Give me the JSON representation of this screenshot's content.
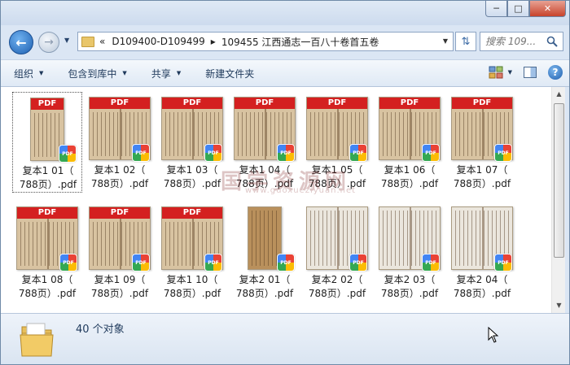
{
  "window": {
    "minimize_glyph": "─",
    "maximize_glyph": "□",
    "close_glyph": "✕"
  },
  "address": {
    "overflow": "«",
    "segments": [
      "D109400-D109499",
      "109455 江西通志一百八十卷首五卷"
    ],
    "separator": "▸"
  },
  "search": {
    "placeholder": "搜索 109..."
  },
  "toolbar": {
    "organize": "组织",
    "include_library": "包含到库中",
    "share": "共享",
    "new_folder": "新建文件夹"
  },
  "files": [
    {
      "name": "复本1 01（788页）.pdf",
      "line1": "复本1 01（",
      "line2": "788页）.pdf",
      "style": "narrow"
    },
    {
      "name": "复本1 02（788页）.pdf",
      "line1": "复本1 02（",
      "line2": "788页）.pdf",
      "style": "wide"
    },
    {
      "name": "复本1 03（788页）.pdf",
      "line1": "复本1 03（",
      "line2": "788页）.pdf",
      "style": "wide"
    },
    {
      "name": "复本1 04（788页）.pdf",
      "line1": "复本1 04（",
      "line2": "788页）.pdf",
      "style": "wide"
    },
    {
      "name": "复本1 05（788页）.pdf",
      "line1": "复本1 05（",
      "line2": "788页）.pdf",
      "style": "wide"
    },
    {
      "name": "复本1 06（788页）.pdf",
      "line1": "复本1 06（",
      "line2": "788页）.pdf",
      "style": "wide"
    },
    {
      "name": "复本1 07（788页）.pdf",
      "line1": "复本1 07（",
      "line2": "788页）.pdf",
      "style": "wide"
    },
    {
      "name": "复本1 08（788页）.pdf",
      "line1": "复本1 08（",
      "line2": "788页）.pdf",
      "style": "wide"
    },
    {
      "name": "复本1 09（788页）.pdf",
      "line1": "复本1 09（",
      "line2": "788页）.pdf",
      "style": "wide"
    },
    {
      "name": "复本1 10（788页）.pdf",
      "line1": "复本1 10（",
      "line2": "788页）.pdf",
      "style": "wide"
    },
    {
      "name": "复本2 01（788页）.pdf",
      "line1": "复本2 01（",
      "line2": "788页）.pdf",
      "style": "narrow-dark"
    },
    {
      "name": "复本2 02（788页）.pdf",
      "line1": "复本2 02（",
      "line2": "788页）.pdf",
      "style": "pale"
    },
    {
      "name": "复本2 03（788页）.pdf",
      "line1": "复本2 03（",
      "line2": "788页）.pdf",
      "style": "pale"
    },
    {
      "name": "复本2 04（788页）.pdf",
      "line1": "复本2 04（",
      "line2": "788页）.pdf",
      "style": "pale"
    }
  ],
  "pdf_label": "PDF",
  "watermark": {
    "main": "国学资源网",
    "url": "www.guoxueziyuan.net"
  },
  "status": {
    "count_text": "40 个对象"
  }
}
